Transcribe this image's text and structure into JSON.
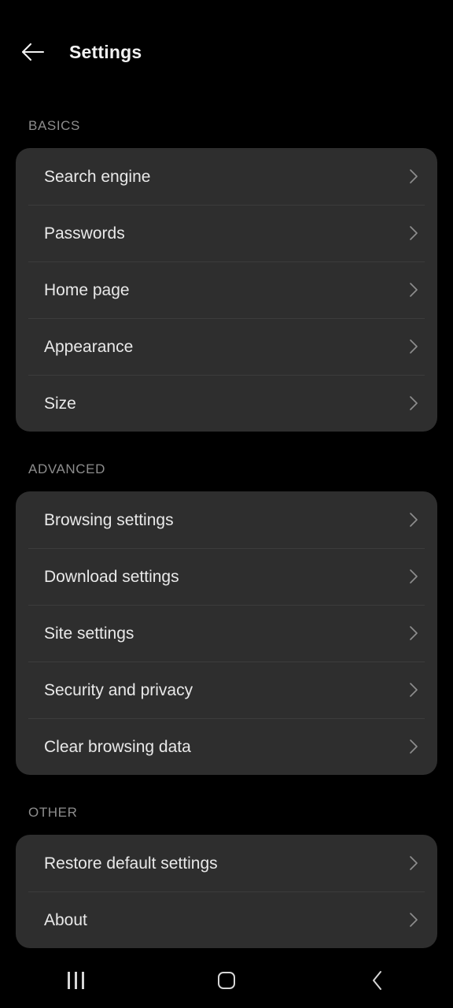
{
  "header": {
    "back_icon": "arrow-left-icon",
    "title": "Settings"
  },
  "sections": [
    {
      "title": "BASICS",
      "items": [
        {
          "label": "Search engine",
          "chevron": "chevron-right-icon"
        },
        {
          "label": "Passwords",
          "chevron": "chevron-right-icon"
        },
        {
          "label": "Home page",
          "chevron": "chevron-right-icon"
        },
        {
          "label": "Appearance",
          "chevron": "chevron-right-icon"
        },
        {
          "label": "Size",
          "chevron": "chevron-right-icon"
        }
      ]
    },
    {
      "title": "ADVANCED",
      "items": [
        {
          "label": "Browsing settings",
          "chevron": "chevron-right-icon"
        },
        {
          "label": "Download settings",
          "chevron": "chevron-right-icon"
        },
        {
          "label": "Site settings",
          "chevron": "chevron-right-icon"
        },
        {
          "label": "Security and privacy",
          "chevron": "chevron-right-icon"
        },
        {
          "label": "Clear browsing data",
          "chevron": "chevron-right-icon"
        }
      ]
    },
    {
      "title": "OTHER",
      "items": [
        {
          "label": "Restore default settings",
          "chevron": "chevron-right-icon"
        },
        {
          "label": "About",
          "chevron": "chevron-right-icon"
        }
      ]
    }
  ],
  "navbar": {
    "recents_label": "recents-icon",
    "home_label": "home-icon",
    "back_label": "back-icon"
  },
  "colors": {
    "background": "#000000",
    "card": "#2e2e2e",
    "divider": "#3c3c3c",
    "primary_text": "#e9e9e9",
    "secondary_text": "#8d8d8d",
    "title_text": "#f2f2f2",
    "chevron": "#8d8d8d",
    "nav_icon": "#d6d6d6"
  }
}
